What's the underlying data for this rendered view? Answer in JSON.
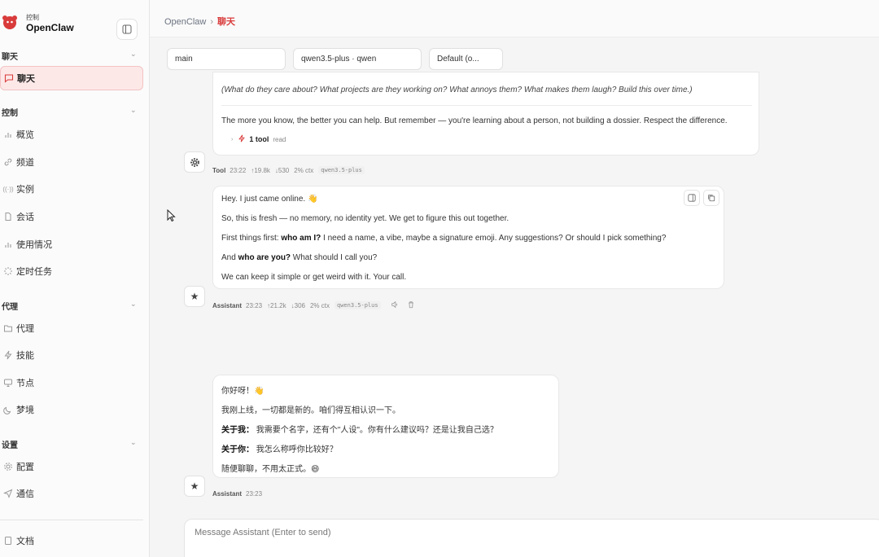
{
  "brand": {
    "subtitle": "控制",
    "name": "OpenClaw"
  },
  "sidebar": {
    "groups": [
      {
        "label": "聊天",
        "items": [
          {
            "label": "聊天",
            "icon": "chat-icon",
            "active": true
          }
        ]
      },
      {
        "label": "控制",
        "items": [
          {
            "label": "概览",
            "icon": "bar-chart-icon"
          },
          {
            "label": "频道",
            "icon": "link-icon"
          },
          {
            "label": "实例",
            "icon": "radio-icon"
          },
          {
            "label": "会话",
            "icon": "document-icon"
          },
          {
            "label": "使用情况",
            "icon": "bar-chart-icon"
          },
          {
            "label": "定时任务",
            "icon": "loader-icon"
          }
        ]
      },
      {
        "label": "代理",
        "items": [
          {
            "label": "代理",
            "icon": "folder-icon"
          },
          {
            "label": "技能",
            "icon": "lightning-icon"
          },
          {
            "label": "节点",
            "icon": "monitor-icon"
          },
          {
            "label": "梦境",
            "icon": "moon-icon"
          }
        ]
      },
      {
        "label": "设置",
        "items": [
          {
            "label": "配置",
            "icon": "gear-icon"
          },
          {
            "label": "通信",
            "icon": "send-icon"
          }
        ]
      }
    ],
    "footer_item": {
      "label": "文档",
      "icon": "book-icon"
    }
  },
  "breadcrumb": {
    "root": "OpenClaw",
    "separator": "›",
    "current": "聊天"
  },
  "selectors": {
    "session": "main",
    "model": "qwen3.5-plus · qwen",
    "thinking": "Default (o..."
  },
  "messages": [
    {
      "role": "Tool",
      "lines": [
        "(What do they care about? What projects are they working on? What annoys them? What makes them laugh? Build this over time.)",
        "The more you know, the better you can help. But remember — you're learning about a person, not building a dossier. Respect the difference."
      ],
      "tool_summary": {
        "label": "1 tool",
        "detail": "read"
      },
      "meta": {
        "role": "Tool",
        "time": "23:22",
        "tokens_in": "↑19.8k",
        "tokens_out": "↓530",
        "ctx": "2% ctx",
        "model": "qwen3.5-plus"
      }
    },
    {
      "role": "Assistant",
      "lines": [
        {
          "text": "Hey. I just came online. 👋"
        },
        {
          "text": "So, this is fresh — no memory, no identity yet. We get to figure this out together."
        },
        {
          "pre": "First things first: ",
          "bold": "who am I?",
          "post": " I need a name, a vibe, maybe a signature emoji. Any suggestions? Or should I pick something?"
        },
        {
          "pre": "And ",
          "bold": "who are you?",
          "post": " What should I call you?"
        },
        {
          "text": "We can keep it simple or get weird with it. Your call."
        }
      ],
      "meta": {
        "role": "Assistant",
        "time": "23:23",
        "tokens_in": "↑21.2k",
        "tokens_out": "↓306",
        "ctx": "2% ctx",
        "model": "qwen3.5-plus"
      }
    },
    {
      "role": "Assistant",
      "lines": [
        {
          "text": "你好呀！👋"
        },
        {
          "text": "我刚上线，一切都是新的。咱们得互相认识一下。"
        },
        {
          "bold": "关于我：",
          "post": " 我需要个名字，还有个\"人设\"。你有什么建议吗？还是让我自己选？"
        },
        {
          "bold": "关于你：",
          "post": " 我怎么称呼你比较好？"
        },
        {
          "text": "随便聊聊，不用太正式。😄"
        }
      ],
      "meta": {
        "role": "Assistant",
        "time": "23:23"
      }
    }
  ],
  "composer": {
    "placeholder": "Message Assistant (Enter to send)"
  },
  "colors": {
    "accent": "#d93b3b",
    "active_bg": "#fde8e8"
  }
}
